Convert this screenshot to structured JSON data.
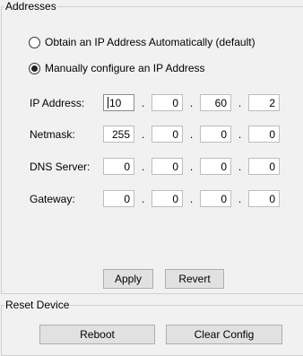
{
  "addresses": {
    "legend": "Addresses",
    "radio_auto": {
      "label": "Obtain an IP Address Automatically (default)",
      "selected": false
    },
    "radio_manual": {
      "label": "Manually configure an IP Address",
      "selected": true
    },
    "fields": [
      {
        "label": "IP Address:",
        "octets": [
          "10",
          "0",
          "60",
          "2"
        ]
      },
      {
        "label": "Netmask:",
        "octets": [
          "255",
          "0",
          "0",
          "0"
        ]
      },
      {
        "label": "DNS Server:",
        "octets": [
          "0",
          "0",
          "0",
          "0"
        ]
      },
      {
        "label": "Gateway:",
        "octets": [
          "0",
          "0",
          "0",
          "0"
        ]
      }
    ],
    "separator": ".",
    "apply_label": "Apply",
    "revert_label": "Revert"
  },
  "reset_device": {
    "legend": "Reset Device",
    "reboot_label": "Reboot",
    "clear_config_label": "Clear Config"
  }
}
